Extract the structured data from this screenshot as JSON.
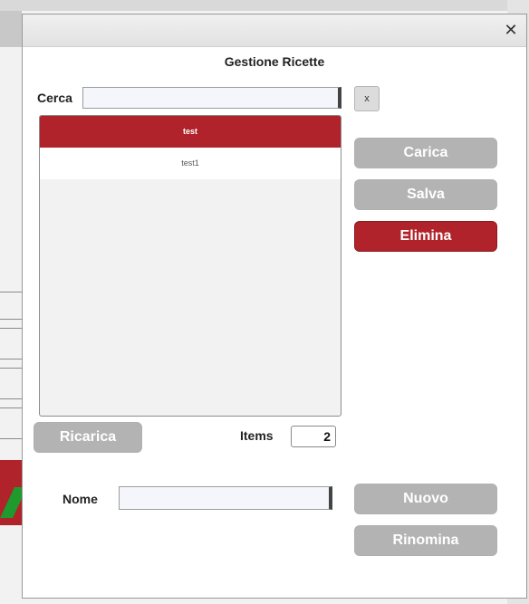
{
  "window": {
    "close_glyph": "✕"
  },
  "dialog": {
    "title": "Gestione Ricette"
  },
  "search": {
    "label": "Cerca",
    "value": "",
    "placeholder": "",
    "clear_label": "x"
  },
  "list": {
    "items": [
      {
        "label": "test",
        "selected": true
      },
      {
        "label": "test1",
        "selected": false
      }
    ]
  },
  "actions": {
    "load": "Carica",
    "save": "Salva",
    "delete": "Elimina"
  },
  "footer": {
    "reload": "Ricarica",
    "items_label": "Items",
    "items_count": "2"
  },
  "name": {
    "label": "Nome",
    "value": ""
  },
  "name_actions": {
    "new": "Nuovo",
    "rename": "Rinomina"
  },
  "colors": {
    "accent": "#b0232a",
    "button_gray": "#b3b3b3"
  }
}
